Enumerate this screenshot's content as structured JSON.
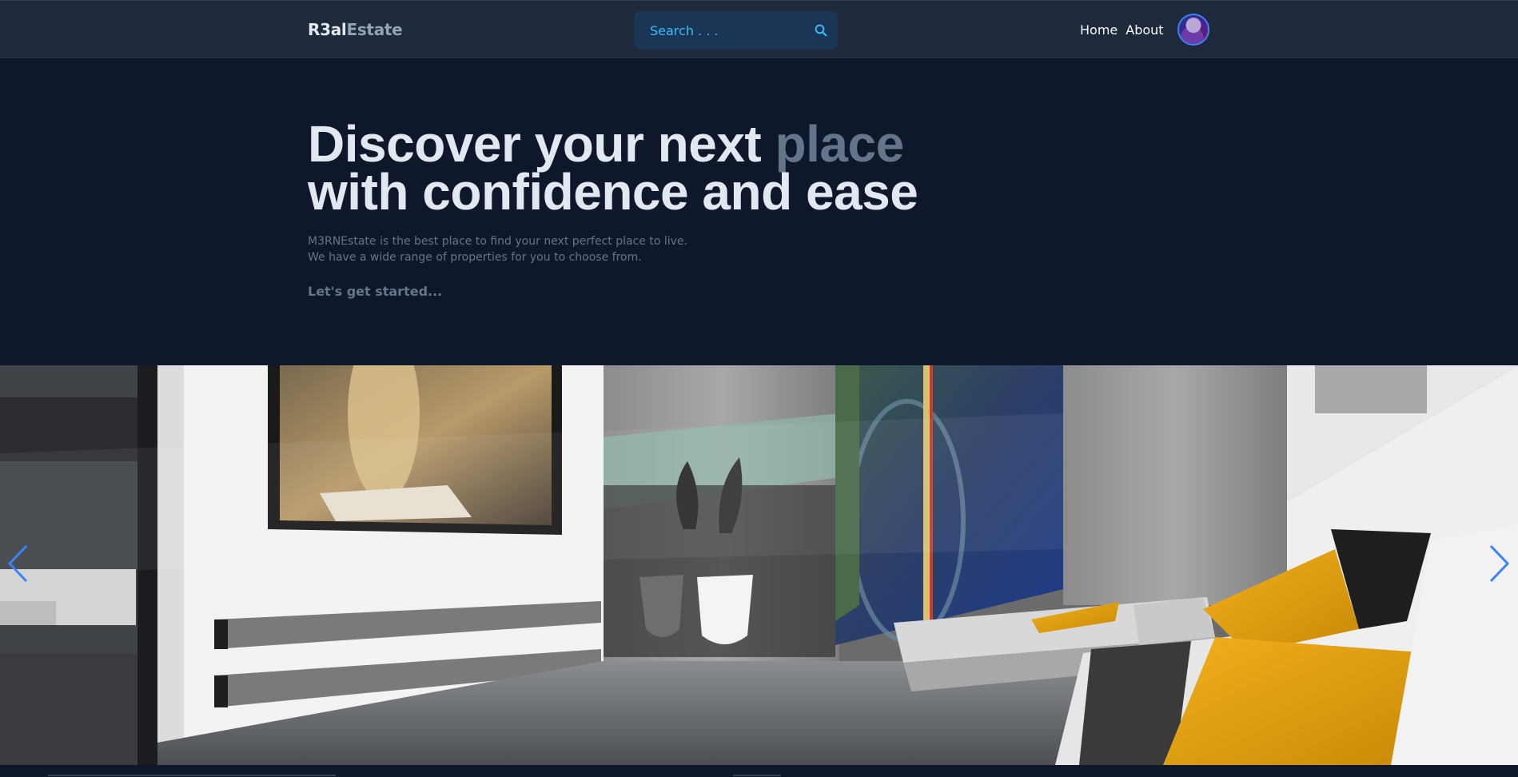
{
  "header": {
    "logo_primary": "R3al",
    "logo_secondary": "Estate",
    "search_placeholder": "Search . . .",
    "nav": [
      "Home",
      "About"
    ]
  },
  "hero": {
    "title_line1_start": "Discover your next ",
    "title_line1_highlight": "place",
    "title_line2": "with confidence and ease",
    "description_line1": "M3RNEstate is the best place to find your next perfect place to live.",
    "description_line2": "We have a wide range of properties for you to choose from.",
    "cta": "Let's get started..."
  },
  "colors": {
    "background": "#0f172a",
    "header": "#1e293b",
    "search": "#1a3556",
    "accent": "#38bdf8",
    "muted": "#64748b",
    "arrow": "#3b82f6"
  },
  "icons": [
    "search-icon",
    "chevron-left-icon",
    "chevron-right-icon"
  ]
}
